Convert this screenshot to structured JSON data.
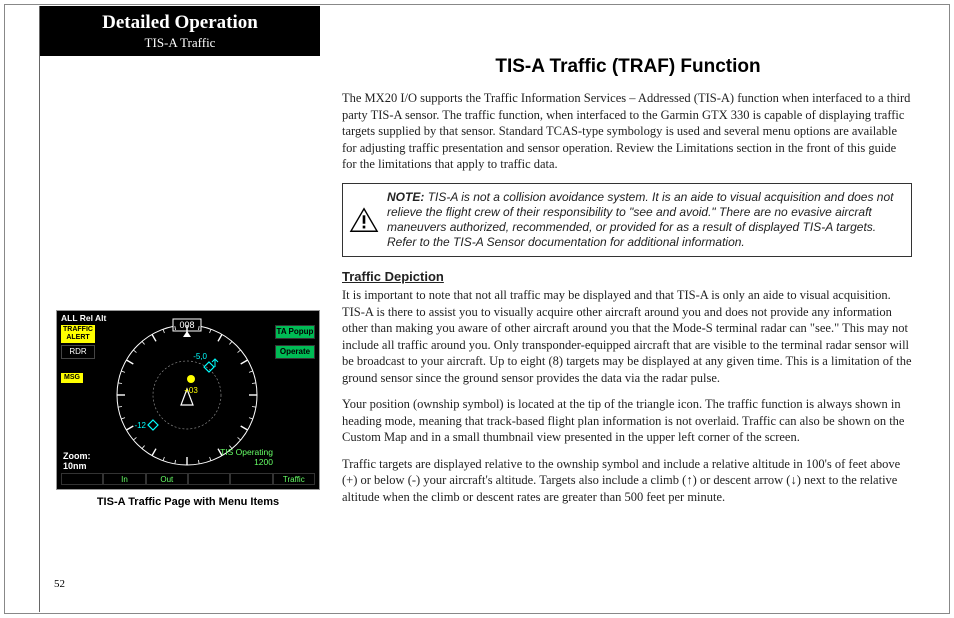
{
  "header": {
    "title": "Detailed Operation",
    "subtitle": "TIS-A Traffic"
  },
  "main_heading": "TIS-A Traffic (TRAF) Function",
  "intro_para": "The MX20 I/O supports the Traffic Information Services – Addressed (TIS-A) function when interfaced to a third party TIS-A sensor. The traffic function, when interfaced to the Garmin GTX 330 is capable of displaying traffic targets supplied by that sensor. Standard TCAS-type symbology is used and several menu options are available for adjusting traffic presentation and sensor operation. Review the Limitations section in the front of this guide for the limitations that apply to traffic data.",
  "note": {
    "label": "NOTE:",
    "text": "TIS-A is not a collision avoidance system. It is an aide to visual acquisition and does not relieve the flight crew of their responsibility to \"see and avoid.\" There are no evasive aircraft maneuvers authorized, recommended, or provided for as a result of displayed TIS-A targets. Refer to the TIS-A Sensor documentation for additional information."
  },
  "section_heading": "Traffic Depiction",
  "para2": "It is important to note that not all traffic may be displayed and that TIS-A is only an aide to visual acquisition. TIS-A is there to assist you to visually acquire other aircraft around you and does not provide any information other than making you aware of other aircraft around you that the Mode-S terminal radar can \"see.\" This may not include all traffic around you. Only transponder-equipped aircraft that are visible to the terminal radar sensor will be broadcast to your aircraft. Up to eight (8) targets may be displayed at any given time. This is a limitation of the ground sensor since the ground sensor provides the data via the radar pulse.",
  "para3": "Your position (ownship symbol) is located at the tip of the triangle icon. The traffic function is always shown in heading mode, meaning that track-based flight plan information is not overlaid. Traffic can also be shown on the Custom Map and in a small thumbnail view presented in the upper left corner of the screen.",
  "para4_a": "Traffic targets are displayed relative to the ownship symbol and include a relative altitude in 100's of feet above (+) or below (-) your aircraft's altitude. Targets also include a climb (",
  "para4_b": ") or descent arrow (",
  "para4_c": ") next to the relative altitude when the climb or descent rates are greater than 500 feet per minute.",
  "page_number": "52",
  "figure": {
    "caption": "TIS-A Traffic Page with Menu Items",
    "top_left": "ALL Rel Alt",
    "traffic_alert_l1": "TRAFFIC",
    "traffic_alert_l2": "ALERT",
    "rdr": "RDR",
    "msg": "MSG",
    "ta_popup": "TA Popup",
    "operate": "Operate",
    "hdg": "008",
    "tgt1": "-5,0",
    "tgt2": "+03",
    "tgt3": "-12",
    "zoom_label": "Zoom:",
    "zoom_value": "10nm",
    "tis_operating": "TIS Operating",
    "tis_code": "1200",
    "bottom_in": "In",
    "bottom_out": "Out",
    "bottom_traffic": "Traffic"
  }
}
